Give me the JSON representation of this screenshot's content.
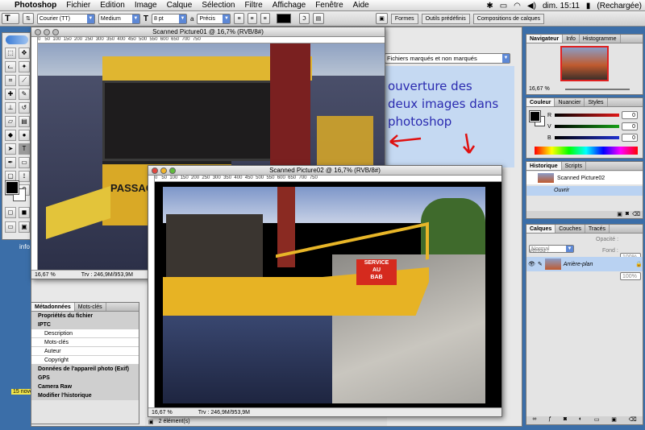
{
  "menubar": {
    "app": "Photoshop",
    "items": [
      "Fichier",
      "Edition",
      "Image",
      "Calque",
      "Sélection",
      "Filtre",
      "Affichage",
      "Fenêtre",
      "Aide"
    ],
    "clock": "dim. 15:11",
    "battery": "(Rechargée)"
  },
  "optbar": {
    "font_family": "Courier (TT)",
    "font_style": "Medium",
    "font_size": "8 pt",
    "aa_label": "a",
    "aa_value": "Précis",
    "well_tabs": [
      "Formes",
      "Outils prédéfinis",
      "Compositions de calques"
    ]
  },
  "browser": {
    "filter": "Fichiers marqués et non marqués",
    "items_count": "2 élément(s)",
    "annotation": "ouverture des\ndeux images dans\nphotoshop"
  },
  "doc1": {
    "title": "Scanned Picture01 @ 16,7% (RVB/8#)",
    "zoom": "16,67 %",
    "info": "Trv : 246,9M/953,9M"
  },
  "doc2": {
    "title": "Scanned Picture02 @ 16,7% (RVB/8#)",
    "zoom": "16,67 %",
    "info": "Trv : 246,9M/953,9M",
    "sign": "SERVICE\nAU\nBAB"
  },
  "doc1_sign": "PASSAG",
  "metadata": {
    "tabs": [
      "Métadonnées",
      "Mots-clés"
    ],
    "rows": [
      {
        "label": "Propriétés du fichier",
        "kind": "sec"
      },
      {
        "label": "IPTC",
        "kind": "sec"
      },
      {
        "label": "Description",
        "kind": "fld"
      },
      {
        "label": "Mots-clés",
        "kind": "fld"
      },
      {
        "label": "Auteur",
        "kind": "fld"
      },
      {
        "label": "Copyright",
        "kind": "fld"
      },
      {
        "label": "Données de l'appareil photo (Exif)",
        "kind": "sec"
      },
      {
        "label": "GPS",
        "kind": "sec"
      },
      {
        "label": "Camera Raw",
        "kind": "sec"
      },
      {
        "label": "Modifier l'historique",
        "kind": "sec"
      }
    ]
  },
  "navigator": {
    "tabs": [
      "Navigateur",
      "Info",
      "Histogramme"
    ],
    "zoom": "16,67 %"
  },
  "color": {
    "tabs": [
      "Couleur",
      "Nuancier",
      "Styles"
    ],
    "channels": [
      {
        "name": "R",
        "value": "0",
        "color": "#d21414"
      },
      {
        "name": "V",
        "value": "0",
        "color": "#18a018"
      },
      {
        "name": "B",
        "value": "0",
        "color": "#2030d0"
      }
    ]
  },
  "history": {
    "tabs": [
      "Historique",
      "Scripts"
    ],
    "snapshot": "Scanned Picture02",
    "state": "Ouvrir"
  },
  "layers": {
    "tabs": [
      "Calques",
      "Couches",
      "Tracés"
    ],
    "blend": "Normal",
    "opacity_label": "Opacité :",
    "opacity": "100%",
    "lock_label": "Verrou :",
    "fill_label": "Fond :",
    "fill": "100%",
    "layer_name": "Arrière-plan"
  },
  "desktop": {
    "label1": "info",
    "label2": "15 nove"
  }
}
